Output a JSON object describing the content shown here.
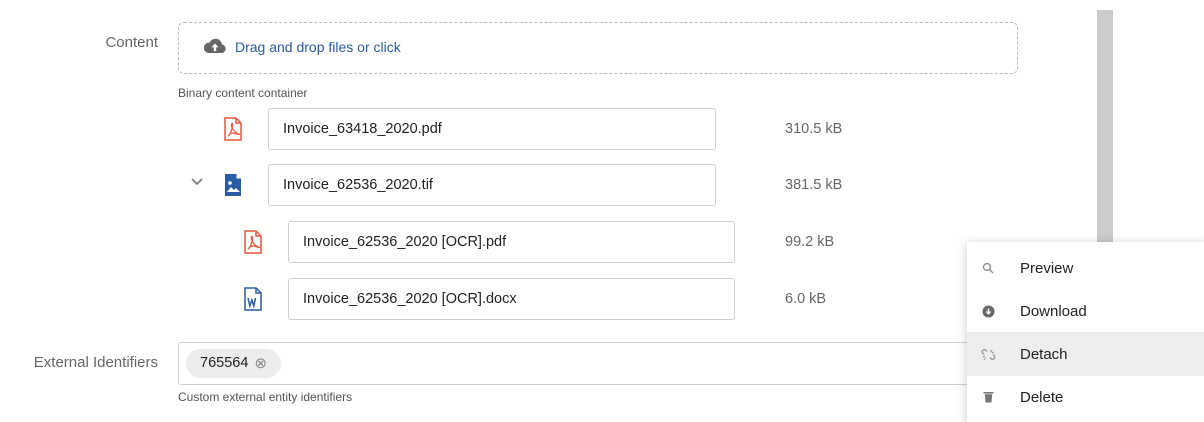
{
  "content_field": {
    "label": "Content",
    "dropzone_text": "Drag and drop files or click",
    "hint": "Binary content container"
  },
  "files": [
    {
      "name": "Invoice_63418_2020.pdf",
      "size": "310.5 kB",
      "type": "pdf"
    },
    {
      "name": "Invoice_62536_2020.tif",
      "size": "381.5 kB",
      "type": "image",
      "expanded": true
    },
    {
      "name": "Invoice_62536_2020 [OCR].pdf",
      "size": "99.2 kB",
      "type": "pdf"
    },
    {
      "name": "Invoice_62536_2020 [OCR].docx",
      "size": "6.0 kB",
      "type": "word"
    }
  ],
  "external_identifiers": {
    "label": "External Identifiers",
    "chip": "765564",
    "hint": "Custom external entity identifiers"
  },
  "context_menu": {
    "items": [
      {
        "label": "Preview",
        "icon": "search-icon"
      },
      {
        "label": "Download",
        "icon": "download-icon"
      },
      {
        "label": "Detach",
        "icon": "unlink-icon",
        "highlighted": true
      },
      {
        "label": "Delete",
        "icon": "trash-icon"
      }
    ]
  },
  "colors": {
    "link": "#2a5ba5",
    "pdf": "#e8553d",
    "image": "#2a5ba5",
    "word": "#2a5ba5",
    "highlight": "#eeeeee"
  }
}
